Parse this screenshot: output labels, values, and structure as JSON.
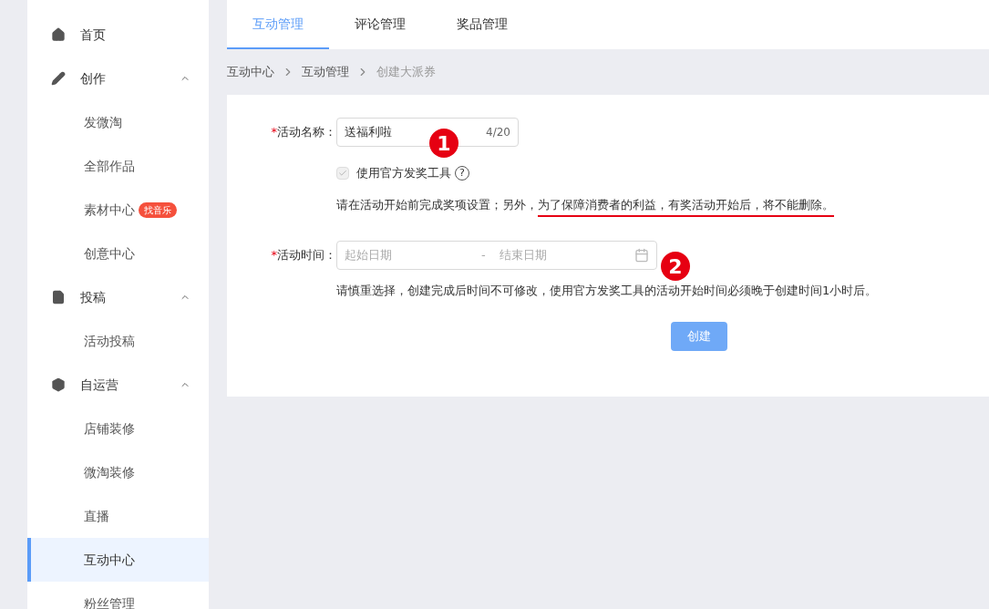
{
  "sidebar": {
    "items": [
      {
        "label": "首页",
        "selected": false
      },
      {
        "label": "创作",
        "expanded": true,
        "children": [
          {
            "label": "发微淘",
            "selected": false
          },
          {
            "label": "全部作品",
            "selected": false
          },
          {
            "label": "素材中心",
            "badge": "找音乐",
            "selected": false
          },
          {
            "label": "创意中心",
            "selected": false
          }
        ]
      },
      {
        "label": "投稿",
        "expanded": true,
        "children": [
          {
            "label": "活动投稿",
            "selected": false
          }
        ]
      },
      {
        "label": "自运营",
        "expanded": true,
        "children": [
          {
            "label": "店铺装修",
            "selected": false
          },
          {
            "label": "微淘装修",
            "selected": false
          },
          {
            "label": "直播",
            "selected": false
          },
          {
            "label": "互动中心",
            "selected": true
          },
          {
            "label": "粉丝管理",
            "selected": false
          }
        ]
      }
    ]
  },
  "tabs": [
    {
      "label": "互动管理",
      "selected": true
    },
    {
      "label": "评论管理",
      "selected": false
    },
    {
      "label": "奖品管理",
      "selected": false
    }
  ],
  "breadcrumb": [
    "互动中心",
    "互动管理",
    "创建大派券"
  ],
  "form": {
    "name_field": {
      "label": "活动名称：",
      "required_mark": "*",
      "value": "送福利啦",
      "counter": "4/20"
    },
    "checkbox": {
      "label": "使用官方发奖工具",
      "checked": true,
      "disabled": true,
      "help": "?"
    },
    "note_1": {
      "plain": "请在活动开始前完成奖项设置；另外，",
      "underlined": "为了保障消费者的利益，有奖活动开始后，将不能删除。"
    },
    "time_field": {
      "label": "活动时间：",
      "required_mark": "*",
      "start_placeholder": "起始日期",
      "separator": "-",
      "end_placeholder": "结束日期"
    },
    "note_2": "请慎重选择，创建完成后时间不可修改，使用官方发奖工具的活动开始时间必须晚于创建时间1小时后。",
    "submit": {
      "label": "创建",
      "disabled": true
    }
  },
  "annotations": [
    "1",
    "2"
  ]
}
